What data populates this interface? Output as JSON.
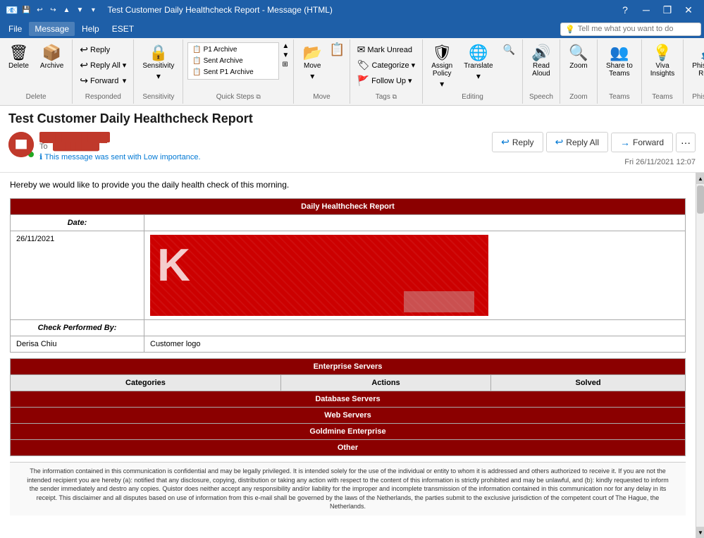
{
  "titlebar": {
    "title": "Test Customer Daily Healthcheck Report - Message (HTML)",
    "controls": [
      "minimize",
      "restore",
      "close"
    ]
  },
  "menubar": {
    "items": [
      "File",
      "Message",
      "Help",
      "ESET"
    ],
    "active": "Message",
    "search_placeholder": "Tell me what you want to do"
  },
  "ribbon": {
    "groups": [
      {
        "name": "Delete",
        "buttons": [
          {
            "id": "delete",
            "label": "Delete",
            "icon": "🗑"
          },
          {
            "id": "archive",
            "label": "Archive",
            "icon": "📦"
          }
        ]
      },
      {
        "name": "Respond",
        "buttons": [
          {
            "id": "reply",
            "label": "Reply",
            "icon": "↩"
          },
          {
            "id": "reply-all",
            "label": "Reply All",
            "icon": "↩↩"
          },
          {
            "id": "forward",
            "label": "Forward",
            "icon": "↪"
          }
        ]
      },
      {
        "name": "Sensitivity",
        "buttons": [
          {
            "id": "sensitivity",
            "label": "Sensitivity",
            "icon": "🔒"
          }
        ]
      },
      {
        "name": "Quick Steps",
        "items": [
          "P1 Archive",
          "Sent Archive",
          "Sent P1 Archive"
        ]
      },
      {
        "name": "Move",
        "buttons": [
          {
            "id": "move",
            "label": "Move",
            "icon": "📂"
          }
        ]
      },
      {
        "name": "Tags",
        "buttons": [
          {
            "id": "mark-unread",
            "label": "Mark Unread",
            "icon": "✉"
          },
          {
            "id": "categorize",
            "label": "Categorize",
            "icon": "🏷"
          },
          {
            "id": "follow-up",
            "label": "Follow Up",
            "icon": "🚩"
          }
        ]
      },
      {
        "name": "Editing",
        "buttons": [
          {
            "id": "assign-policy",
            "label": "Assign Policy",
            "icon": "🛡"
          },
          {
            "id": "translate",
            "label": "Translate",
            "icon": "🌐"
          }
        ]
      },
      {
        "name": "Speech",
        "buttons": [
          {
            "id": "read-aloud",
            "label": "Read Aloud",
            "icon": "🔊"
          }
        ]
      },
      {
        "name": "Zoom",
        "buttons": [
          {
            "id": "zoom",
            "label": "Zoom",
            "icon": "🔍"
          }
        ]
      },
      {
        "name": "Teams",
        "buttons": [
          {
            "id": "share-to-teams",
            "label": "Share to Teams",
            "icon": "👥"
          }
        ]
      },
      {
        "name": "Teams",
        "buttons": [
          {
            "id": "viva-insights",
            "label": "Viva Insights",
            "icon": "💡"
          }
        ]
      },
      {
        "name": "Phish Alert",
        "buttons": [
          {
            "id": "phish-alert",
            "label": "Phish Alert Report",
            "icon": "⚠"
          }
        ]
      }
    ]
  },
  "email": {
    "subject": "Test Customer Daily Healthcheck Report",
    "sender": {
      "name": "██████████",
      "to_label": "To",
      "recipient": "████████",
      "importance_msg": "This message was sent with Low importance."
    },
    "date": "Fri 26/11/2021 12:07",
    "body": {
      "intro": "Hereby we would like to provide you the daily health check of this morning.",
      "table": {
        "title": "Daily Healthcheck Report",
        "date_label": "Date:",
        "date_value": "26/11/2021",
        "check_performed_by_label": "Check Performed By:",
        "performer_name": "Derisa Chiu",
        "performer_logo": "Customer logo",
        "enterprise_title": "Enterprise Servers",
        "columns": [
          "Categories",
          "Actions",
          "Solved"
        ],
        "subsections": [
          "Database Servers",
          "Web Servers",
          "Goldmine Enterprise",
          "Other"
        ]
      }
    },
    "disclaimer": "The information contained in this communication is confidential and may be legally privileged. It is intended solely for the use of the individual or entity to whom it is addressed and others authorized to receive it. If you are not the intended recipient you are hereby (a): notified that any disclosure, copying, distribution or taking any action with respect to the content of this information is strictly prohibited and may be unlawful, and (b): kindly requested to inform the sender immediately and destro any copies. Quistor does neither accept any responsibility and/or liability for the improper and incomplete transmission of the information contained in this communication nor for any delay in its receipt. This disclaimer and all disputes based on use of information from this e-mail shall be governed by the laws of the Netherlands, the parties submit to the exclusive jurisdiction of the competent court of The Hague, the Netherlands."
  },
  "buttons": {
    "reply": "Reply",
    "reply_all": "Reply All",
    "forward": "Forward"
  }
}
